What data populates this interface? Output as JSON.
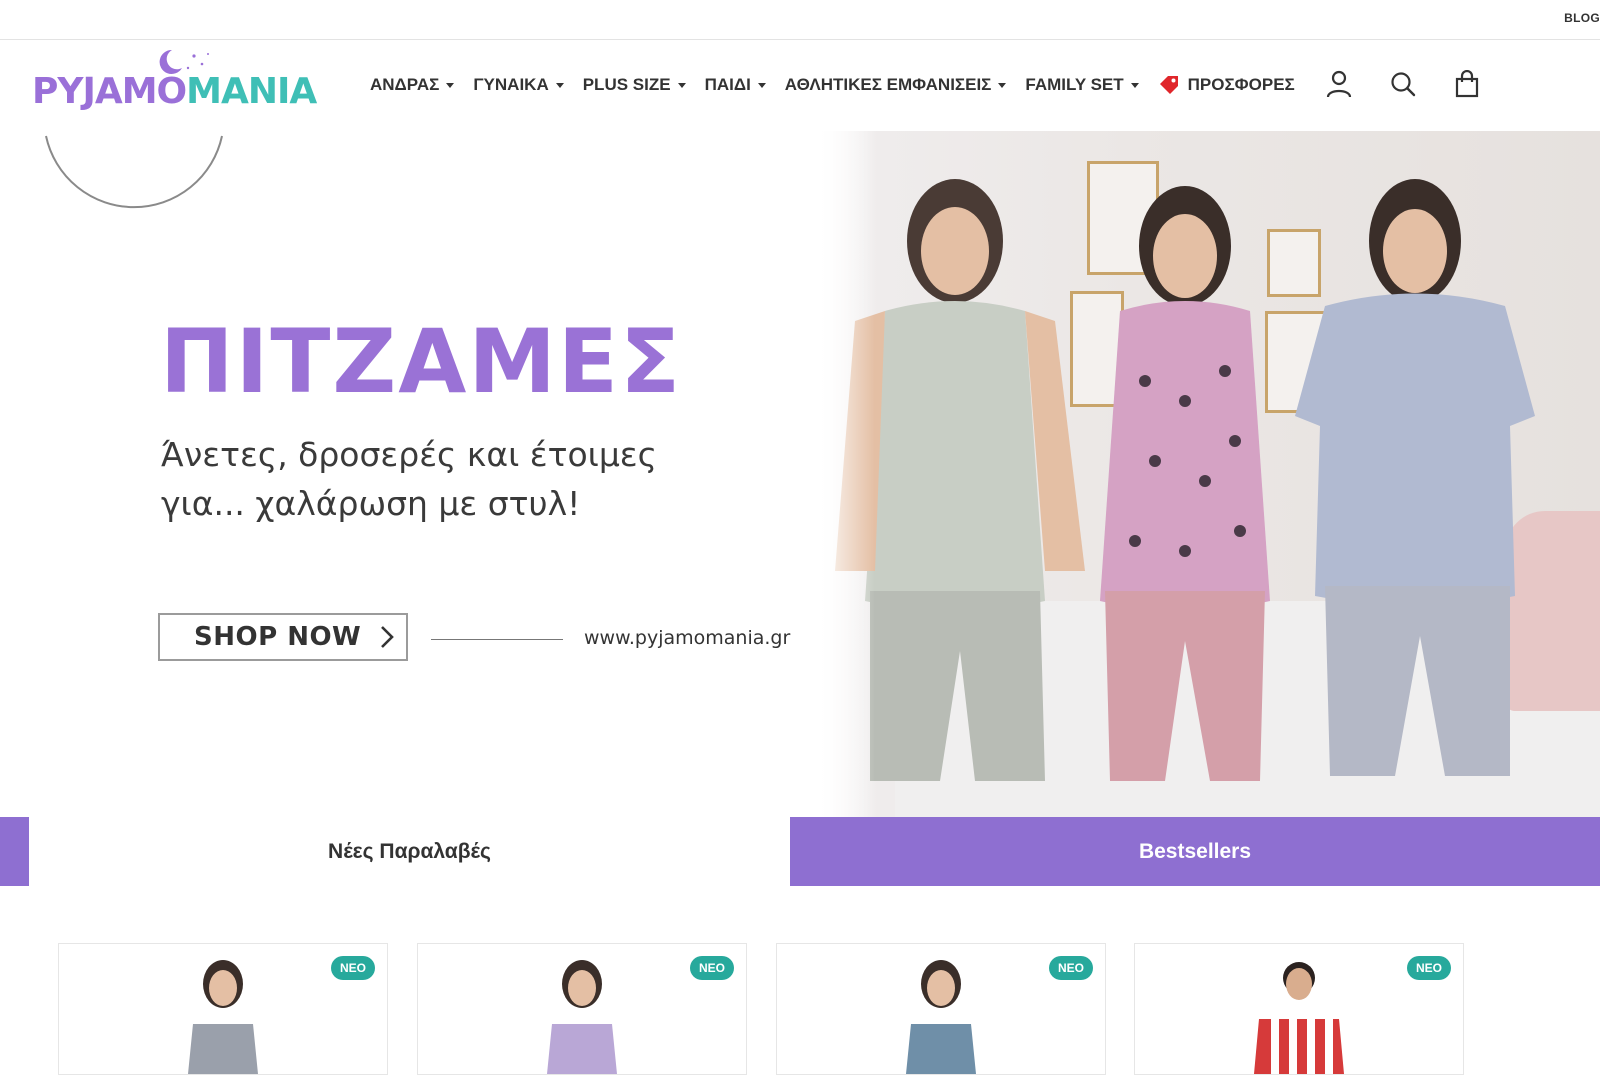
{
  "topbar": {
    "blog": "BLOG"
  },
  "logo": {
    "part1": "PYJAMO",
    "part2": "MANIA"
  },
  "nav": {
    "items": [
      {
        "label": "ΑΝΔΡΑΣ"
      },
      {
        "label": "ΓΥΝΑΙΚΑ"
      },
      {
        "label": "PLUS SIZE"
      },
      {
        "label": "ΠΑΙΔΙ"
      },
      {
        "label": "ΑΘΛΗΤΙΚΕΣ ΕΜΦΑΝΙΣΕΙΣ"
      },
      {
        "label": "FAMILY SET"
      }
    ],
    "offers": "ΠΡΟΣΦΟΡΕΣ"
  },
  "header_icons": [
    "user-icon",
    "search-icon",
    "bag-icon"
  ],
  "hero": {
    "title": "ΠΙΤΖΑΜΕΣ",
    "subtitle_line1": "Άνετες, δροσερές και έτοιμες",
    "subtitle_line2": "για... χαλάρωση με στυλ!",
    "button": "SHOP NOW",
    "url": "www.pyjamomania.gr"
  },
  "tabs": {
    "new": "Νέες Παραλαβές",
    "best": "Bestsellers"
  },
  "products": [
    {
      "badge": "NEO"
    },
    {
      "badge": "NEO"
    },
    {
      "badge": "NEO"
    },
    {
      "badge": "NEO"
    }
  ],
  "colors": {
    "accent": "#8e6fd1",
    "teal": "#27a99c",
    "title": "#9a72d6"
  }
}
